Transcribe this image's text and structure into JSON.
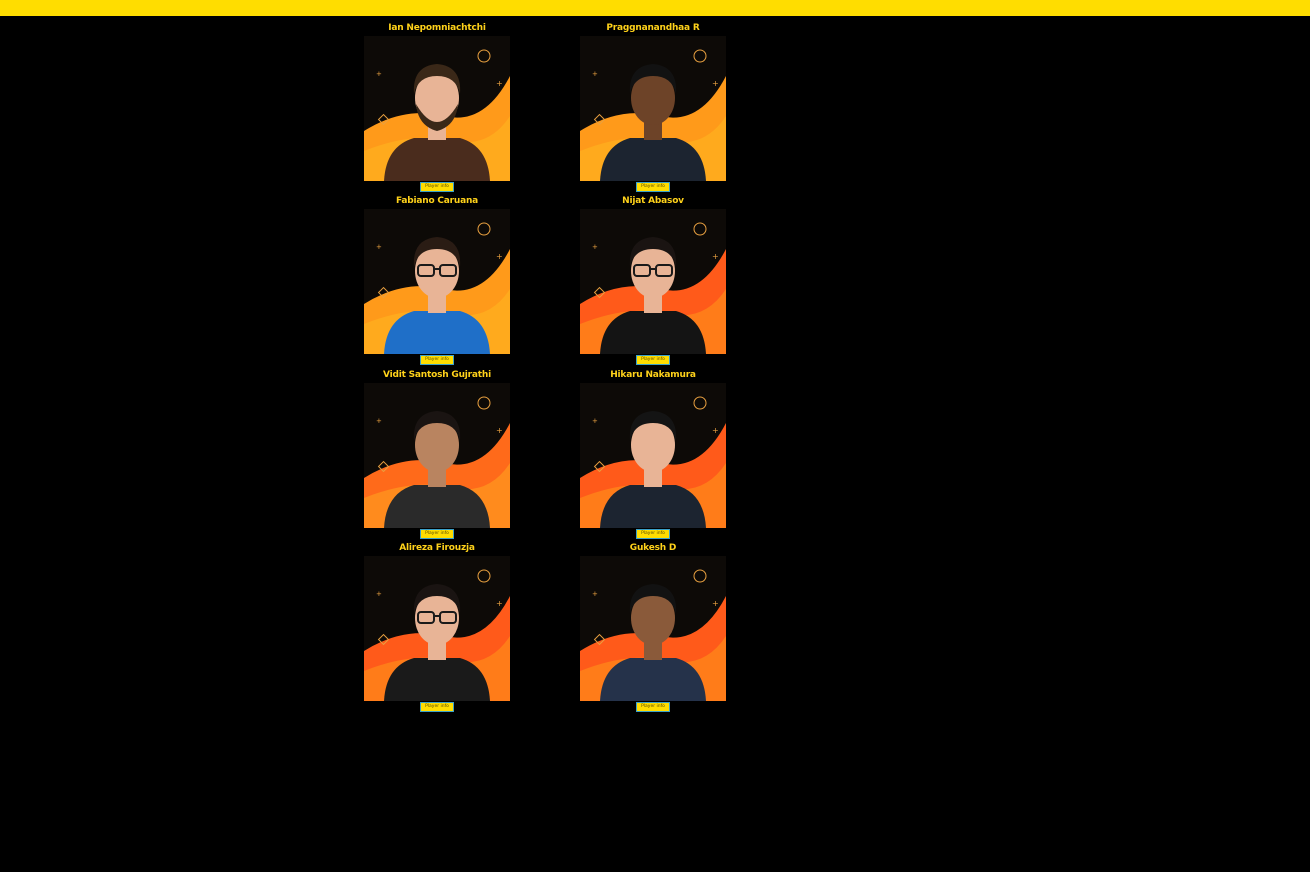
{
  "header": {
    "bar_color": "#FFDD00"
  },
  "theme": {
    "accent": "#FFDD00",
    "name_color": "#FFD21A",
    "background": "#000000"
  },
  "players": [
    {
      "name": "Ian Nepomniachtchi",
      "button_label": "Player info",
      "variant": "orange",
      "hair": "#3a2818",
      "top": "#4a2c1d",
      "beard": true
    },
    {
      "name": "Praggnanandhaa R",
      "button_label": "Player info",
      "variant": "orange",
      "hair": "#121212",
      "top": "#1c2430",
      "skin": "#6d4328"
    },
    {
      "name": "Fabiano Caruana",
      "button_label": "Player info",
      "variant": "orange",
      "hair": "#2a1c14",
      "top": "#1f6fc8",
      "glasses": true
    },
    {
      "name": "Nijat Abasov",
      "button_label": "Player info",
      "variant": "red",
      "hair": "#1a1412",
      "top": "#141414",
      "glasses": true
    },
    {
      "name": "Vidit Santosh Gujrathi",
      "button_label": "Player info",
      "variant": "dark",
      "hair": "#1a1412",
      "top": "#2a2a2a",
      "skin": "#b98460"
    },
    {
      "name": "Hikaru Nakamura",
      "button_label": "Player info",
      "variant": "red",
      "hair": "#141414",
      "top": "#1c2430"
    },
    {
      "name": "Alireza Firouzja",
      "button_label": "Player info",
      "variant": "red",
      "hair": "#1a1412",
      "top": "#1a1a1a",
      "glasses": true
    },
    {
      "name": "Gukesh D",
      "button_label": "Player info",
      "variant": "red",
      "hair": "#121212",
      "top": "#25324a",
      "skin": "#8a5a3a"
    }
  ]
}
